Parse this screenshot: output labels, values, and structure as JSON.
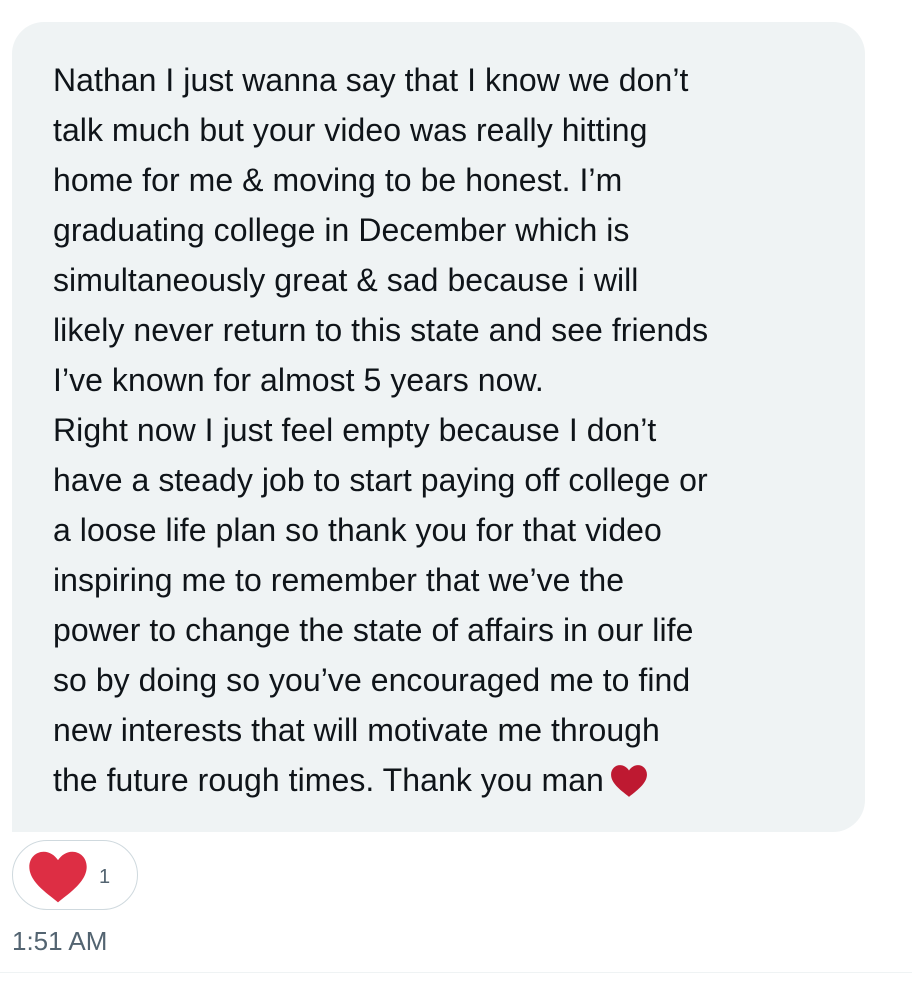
{
  "message": {
    "text": "Nathan I just wanna say that I know we don’t\ntalk much but your video was really hitting\nhome for me & moving to be honest. I’m\ngraduating college in December which is\nsimultaneously great & sad because i will\nlikely never return to this state and see friends\nI’ve known for almost 5 years now.\nRight now I just feel empty because I don’t\nhave a steady job to start paying off college or\na loose life plan so thank you for that video\ninspiring me to remember that we’ve the\npower to change the state of affairs in our life\nso by doing so you’ve encouraged me to find\nnew interests that will motivate me through\nthe future rough times. Thank you man",
    "trailing_emoji": "red-heart-icon",
    "bubble_color": "#eff3f4",
    "text_color": "#0f1419"
  },
  "reaction": {
    "icon": "heart-icon",
    "count": "1",
    "heart_color": "#e0245e"
  },
  "meta": {
    "timestamp": "1:51 AM",
    "muted_color": "#536471"
  }
}
